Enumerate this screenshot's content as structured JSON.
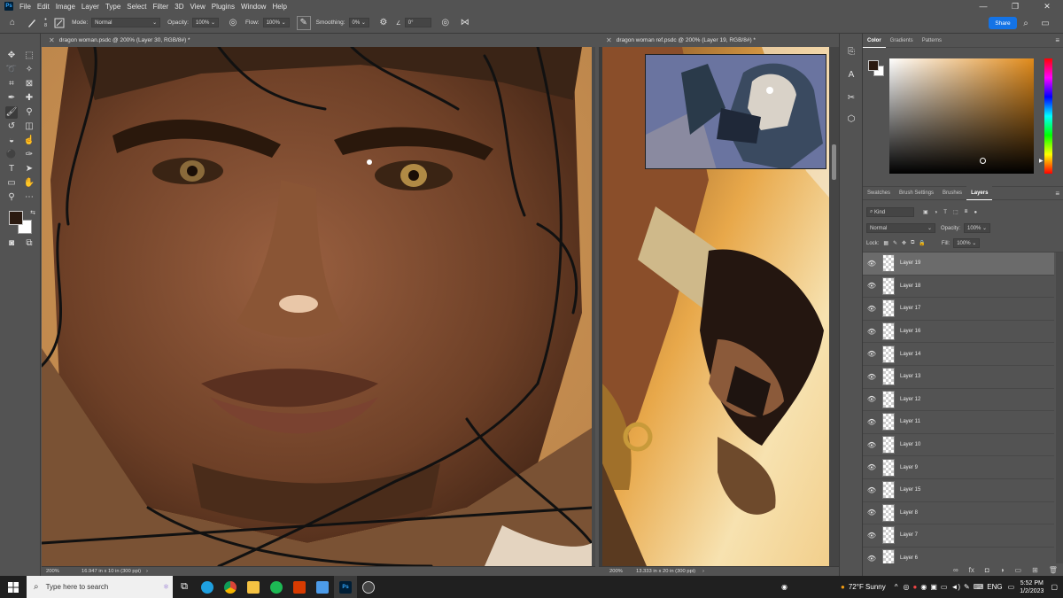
{
  "menu": {
    "logo": "Ps",
    "items": [
      "File",
      "Edit",
      "Image",
      "Layer",
      "Type",
      "Select",
      "Filter",
      "3D",
      "View",
      "Plugins",
      "Window",
      "Help"
    ]
  },
  "options": {
    "brush_size": "8",
    "mode_label": "Mode:",
    "mode_value": "Normal",
    "opacity_label": "Opacity:",
    "opacity_value": "100%",
    "flow_label": "Flow:",
    "flow_value": "100%",
    "smoothing_label": "Smoothing:",
    "smoothing_value": "0%",
    "angle_value": "0°",
    "share_label": "Share"
  },
  "doc_left": {
    "tab_title": "dragon woman.psdc @ 200% (Layer 30, RGB/8#) *",
    "zoom": "200%",
    "size_info": "16.947 in x 10 in (300 ppi)"
  },
  "doc_right": {
    "tab_title": "dragon woman ref.psdc @ 200% (Layer 19, RGB/8#) *",
    "zoom": "200%",
    "size_info": "13.333 in x 20 in (300 ppi)"
  },
  "color_panel": {
    "tabs": [
      "Color",
      "Gradients",
      "Patterns"
    ],
    "active_tab": "Color",
    "foreground": "#2b1a10",
    "background": "#ffffff",
    "hue_color": "#e08a1a"
  },
  "layers_panel": {
    "tabs": [
      "Swatches",
      "Brush Settings",
      "Brushes",
      "Layers"
    ],
    "active_tab": "Layers",
    "filter_kind": "Kind",
    "blend_mode": "Normal",
    "opacity_label": "Opacity:",
    "opacity_value": "100%",
    "lock_label": "Lock:",
    "fill_label": "Fill:",
    "fill_value": "100%",
    "layers": [
      {
        "name": "Layer 19",
        "selected": true
      },
      {
        "name": "Layer 18",
        "selected": false
      },
      {
        "name": "Layer 17",
        "selected": false
      },
      {
        "name": "Layer 16",
        "selected": false
      },
      {
        "name": "Layer 14",
        "selected": false
      },
      {
        "name": "Layer 13",
        "selected": false
      },
      {
        "name": "Layer 12",
        "selected": false
      },
      {
        "name": "Layer 11",
        "selected": false
      },
      {
        "name": "Layer 10",
        "selected": false
      },
      {
        "name": "Layer 9",
        "selected": false
      },
      {
        "name": "Layer 15",
        "selected": false
      },
      {
        "name": "Layer 8",
        "selected": false
      },
      {
        "name": "Layer 7",
        "selected": false
      },
      {
        "name": "Layer 6",
        "selected": false
      }
    ]
  },
  "taskbar": {
    "search_placeholder": "Type here to search",
    "weather": "72°F  Sunny",
    "language": "ENG",
    "time": "5:52 PM",
    "date": "1/2/2023"
  }
}
